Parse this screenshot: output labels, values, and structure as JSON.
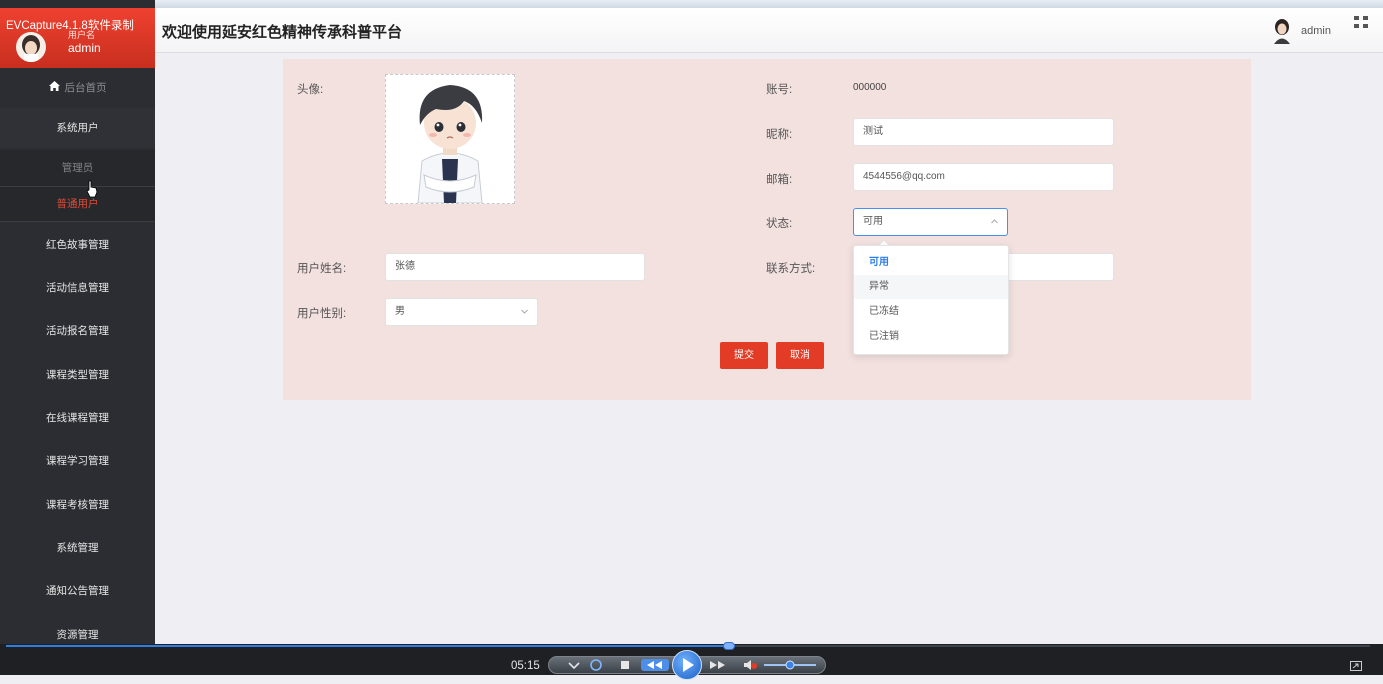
{
  "header": {
    "page_title": "欢迎使用延安红色精神传承科普平台",
    "user_name": "admin"
  },
  "sidebar": {
    "recorder_label": "EVCapture4.1.8软件录制",
    "profile_role": "用户名",
    "profile_name": "admin",
    "home_label": "后台首页",
    "system_user_label": "系统用户",
    "sub_admin_label": "管理员",
    "sub_user_label": "普通用户",
    "items": [
      {
        "label": "红色故事管理"
      },
      {
        "label": "活动信息管理"
      },
      {
        "label": "活动报名管理"
      },
      {
        "label": "课程类型管理"
      },
      {
        "label": "在线课程管理"
      },
      {
        "label": "课程学习管理"
      },
      {
        "label": "课程考核管理"
      },
      {
        "label": "系统管理"
      },
      {
        "label": "通知公告管理"
      },
      {
        "label": "资源管理"
      }
    ]
  },
  "form": {
    "avatar_label": "头像:",
    "account_label": "账号:",
    "account_value": "000000",
    "nickname_label": "昵称:",
    "nickname_value": "测试",
    "email_label": "邮箱:",
    "email_value": "4544556@qq.com",
    "status_label": "状态:",
    "status_value": "可用",
    "realname_label": "用户姓名:",
    "realname_value": "张德",
    "contact_label": "联系方式:",
    "gender_label": "用户性别:",
    "gender_value": "男",
    "submit_label": "提交",
    "cancel_label": "取消"
  },
  "status_options": [
    "可用",
    "异常",
    "已冻结",
    "已注销"
  ],
  "colors": {
    "accent_red": "#e23c26",
    "sidebar_bg": "#2b2d32",
    "selected_option": "#2f7ee6",
    "panel_bg": "#f3e1df"
  },
  "player": {
    "time": "05:15",
    "progress": 0.53
  }
}
